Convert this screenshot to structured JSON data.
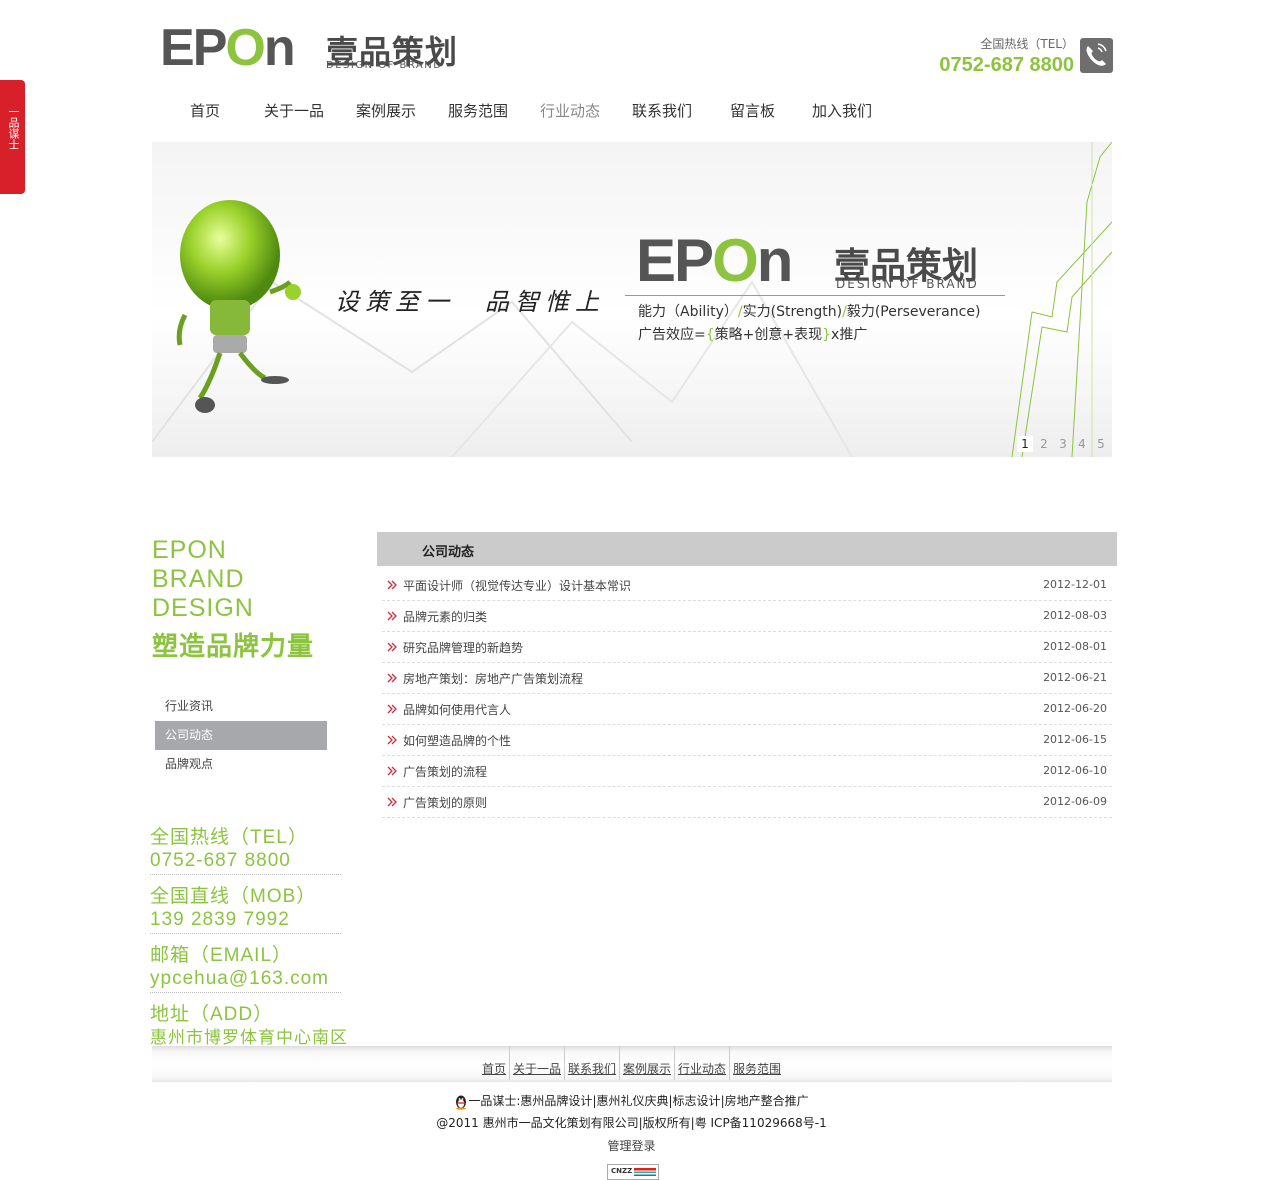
{
  "side_tab": {
    "label": "一品谋士"
  },
  "header": {
    "logo_letters": [
      "E",
      "P",
      "O",
      "n"
    ],
    "logo_cn": "壹品策划",
    "logo_sub": "DESIGN OF BRAND",
    "hotline_label": "全国热线（TEL）",
    "hotline_number": "0752-687 8800"
  },
  "nav": {
    "items": [
      {
        "label": "首页"
      },
      {
        "label": "关于一品"
      },
      {
        "label": "案例展示"
      },
      {
        "label": "服务范围"
      },
      {
        "label": "行业动态"
      },
      {
        "label": "联系我们"
      },
      {
        "label": "留言板"
      },
      {
        "label": "加入我们"
      }
    ],
    "active": "行业动态"
  },
  "banner": {
    "slogan": "设策至一　品智惟上",
    "logo_cn": "壹品策划",
    "logo_sub": "DESIGN OF BRAND",
    "line1_a": "能力（Ability）",
    "line1_sep1": "/",
    "line1_b": "实力(Strength)",
    "line1_sep2": "/",
    "line1_c": "毅力(Perseverance)",
    "line2_a": "广告效应=",
    "line2_b": "{",
    "line2_c": "策略+创意+表现",
    "line2_d": "}",
    "line2_e": "x推广",
    "pager": [
      "1",
      "2",
      "3",
      "4",
      "5"
    ],
    "pager_active": "1"
  },
  "brand_block": {
    "lines": [
      "EPON",
      "BRAND",
      "DESIGN"
    ],
    "cn": "塑造品牌力量"
  },
  "subnav": {
    "items": [
      {
        "label": "行业资讯"
      },
      {
        "label": "公司动态"
      },
      {
        "label": "品牌观点"
      }
    ],
    "active": "公司动态"
  },
  "contacts": [
    {
      "title": "全国热线（TEL）",
      "value": "0752-687 8800"
    },
    {
      "title": "全国直线（MOB）",
      "value": "139 2839 7992"
    },
    {
      "title": "邮箱（EMAIL）",
      "value": "ypcehua@163.com"
    },
    {
      "title": "地址（ADD）",
      "value": "惠州市博罗体育中心南区"
    }
  ],
  "list": {
    "title": "公司动态",
    "rows": [
      {
        "title": "平面设计师（视觉传达专业）设计基本常识",
        "date": "2012-12-01"
      },
      {
        "title": "品牌元素的归类",
        "date": "2012-08-03"
      },
      {
        "title": "研究品牌管理的新趋势",
        "date": "2012-08-01"
      },
      {
        "title": "房地产策划：房地产广告策划流程",
        "date": "2012-06-21"
      },
      {
        "title": "品牌如何使用代言人",
        "date": "2012-06-20"
      },
      {
        "title": "如何塑造品牌的个性",
        "date": "2012-06-15"
      },
      {
        "title": "广告策划的流程",
        "date": "2012-06-10"
      },
      {
        "title": "广告策划的原则",
        "date": "2012-06-09"
      }
    ]
  },
  "footer": {
    "links": [
      "首页",
      "关于一品",
      "联系我们",
      "案例展示",
      "行业动态",
      "服务范围"
    ],
    "seo_label": "一品谋士",
    "seo_links": [
      "惠州品牌设计",
      "惠州礼仪庆典",
      "标志设计",
      "房地产整合推广"
    ],
    "copyright": "@2011 惠州市一品文化策划有限公司|版权所有|粤 ICP备11029668号-1",
    "admin": "管理登录",
    "badge": "CNZZ"
  },
  "colors": {
    "brand_green": "#8cc43f",
    "side_red": "#d8202a",
    "sub_active": "#a6a8ab",
    "list_head": "#cbcbcb"
  }
}
